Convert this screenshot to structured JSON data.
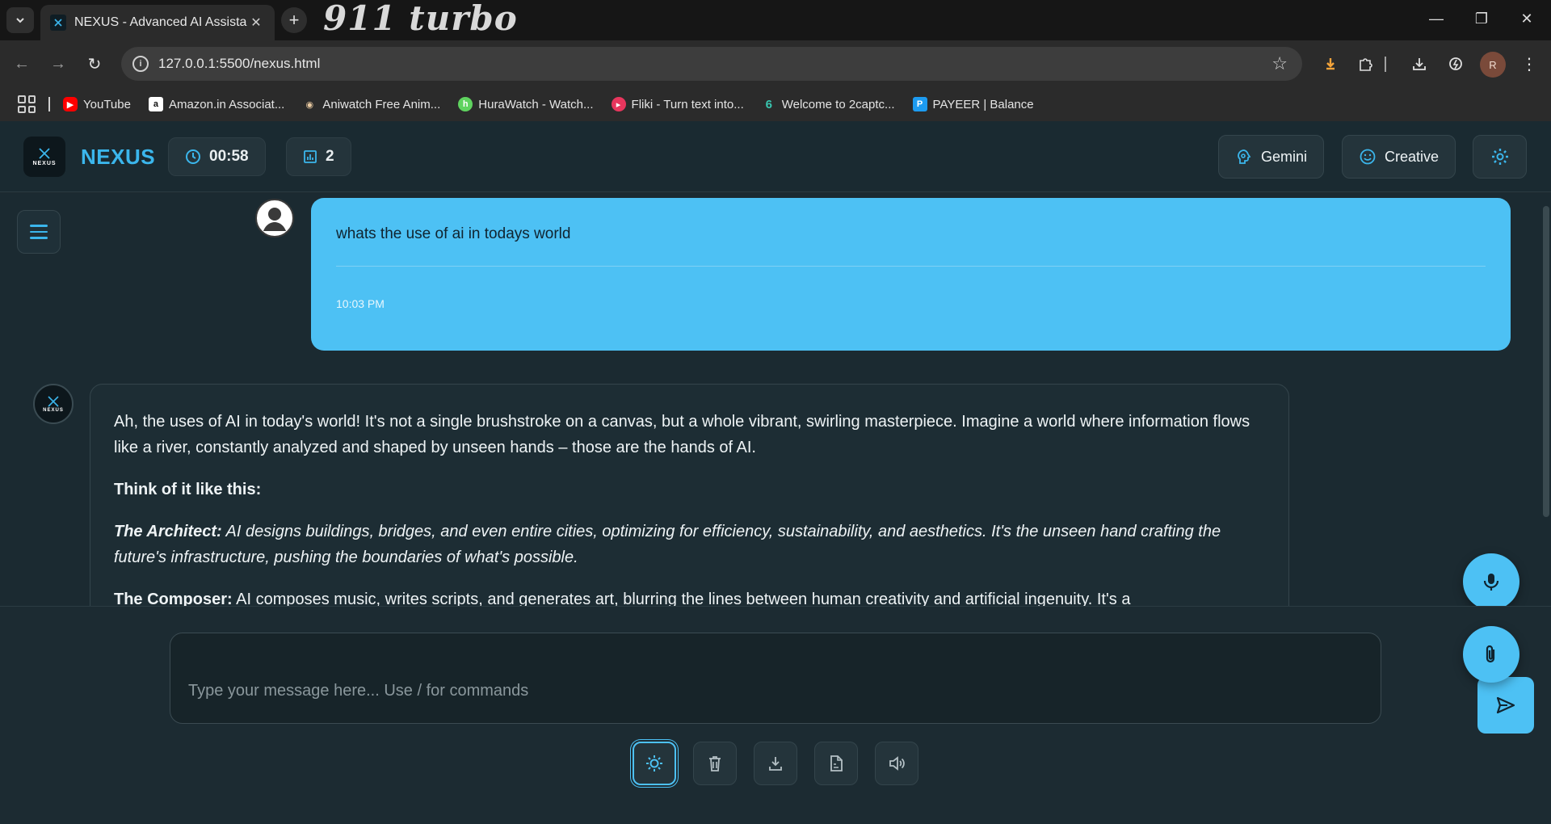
{
  "browser": {
    "tab_title": "NEXUS - Advanced AI Assistant",
    "decor_text": "911 turbo",
    "url": "127.0.0.1:5500/nexus.html",
    "bookmarks": [
      {
        "label": "YouTube",
        "icon": "youtube-icon",
        "color": "#ff0000"
      },
      {
        "label": "Amazon.in Associat...",
        "icon": "amazon-icon",
        "color": "#ffffff"
      },
      {
        "label": "Aniwatch Free Anim...",
        "icon": "aniwatch-icon",
        "color": "#e8c9a0"
      },
      {
        "label": "HuraWatch - Watch...",
        "icon": "hurawatch-icon",
        "color": "#5fd35f"
      },
      {
        "label": "Fliki - Turn text into...",
        "icon": "fliki-icon",
        "color": "#e8365d"
      },
      {
        "label": "Welcome to 2captc...",
        "icon": "2captcha-icon",
        "color": "#39c6b0"
      },
      {
        "label": "PAYEER | Balance",
        "icon": "payeer-icon",
        "color": "#1d9bf0"
      }
    ],
    "profile_initial": "R"
  },
  "header": {
    "app_name": "NEXUS",
    "logo_text": "NEXUS",
    "timer": "00:58",
    "message_count": "2",
    "model_label": "Gemini",
    "mode_label": "Creative"
  },
  "chat": {
    "user_message": {
      "text": "whats the use of ai in todays world",
      "time": "10:03 PM"
    },
    "bot_message": {
      "avatar_text": "NEXUS",
      "intro": "Ah, the uses of AI in today's world! It's not a single brushstroke on a canvas, but a whole vibrant, swirling masterpiece. Imagine a world where information flows like a river, constantly analyzed and shaped by unseen hands – those are the hands of AI.",
      "think_heading": "Think of it like this:",
      "architect_title": "The Architect:",
      "architect_text": " AI designs buildings, bridges, and even entire cities, optimizing for efficiency, sustainability, and aesthetics. It's the unseen hand crafting the future's infrastructure, pushing the boundaries of what's possible.",
      "composer_title": "The Composer:",
      "composer_text": " AI composes music, writes scripts, and generates art, blurring the lines between human creativity and artificial ingenuity. It's a"
    }
  },
  "input": {
    "placeholder": "Type your message here... Use / for commands",
    "value": ""
  },
  "toolbar": {
    "tools": [
      "theme-toggle",
      "clear-chat",
      "download-chat",
      "export",
      "voice-output"
    ]
  },
  "colors": {
    "accent": "#4dc1f4",
    "brand": "#3bb6ec",
    "background": "#1b2a31"
  }
}
